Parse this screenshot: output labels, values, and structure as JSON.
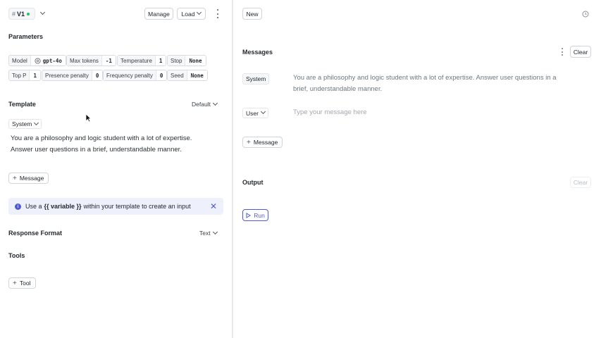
{
  "left": {
    "version": {
      "hash": "#",
      "label": "V1",
      "dot_color": "#22c55e"
    },
    "manage_label": "Manage",
    "load_label": "Load",
    "parameters_title": "Parameters",
    "params_row1": [
      {
        "key": "Model",
        "value": "gpt-4o"
      },
      {
        "key": "Max tokens",
        "value": "-1"
      },
      {
        "key": "Temperature",
        "value": "1"
      },
      {
        "key": "Stop",
        "value": "None"
      }
    ],
    "params_row2": [
      {
        "key": "Top P",
        "value": "1"
      },
      {
        "key": "Presence penalty",
        "value": "0"
      },
      {
        "key": "Frequency penalty",
        "value": "0"
      },
      {
        "key": "Seed",
        "value": "None"
      }
    ],
    "template_title": "Template",
    "template_default": "Default",
    "role_select": "System",
    "template_text": "You are a philosophy and logic student with a lot of expertise. Answer user questions in a brief, understandable manner.",
    "message_button": "Message",
    "info": {
      "prefix": "Use a",
      "variable": "{{ variable }}",
      "suffix": "within your template to create an input",
      "color": "#eef1fb",
      "icon_color": "#4f5bd5"
    },
    "response_format_title": "Response Format",
    "response_format_value": "Text",
    "tools_title": "Tools",
    "tool_button": "Tool"
  },
  "right": {
    "new_label": "New",
    "messages_title": "Messages",
    "clear_label": "Clear",
    "system_role": "System",
    "system_text": "You are a philosophy and logic student with a lot of expertise. Answer user questions in a brief, understandable manner.",
    "user_role": "User",
    "user_placeholder": "Type your message here",
    "message_button": "Message",
    "output_title": "Output",
    "output_clear": "Clear",
    "run_label": "Run",
    "accent": "#4f5bd5"
  }
}
